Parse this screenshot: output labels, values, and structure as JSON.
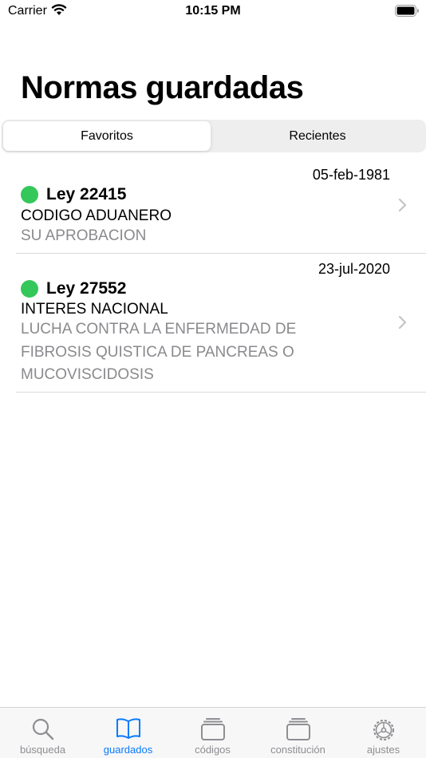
{
  "status_bar": {
    "carrier": "Carrier",
    "time": "10:15 PM"
  },
  "page": {
    "title": "Normas guardadas"
  },
  "segments": [
    {
      "label": "Favoritos",
      "selected": true
    },
    {
      "label": "Recientes",
      "selected": false
    }
  ],
  "items": [
    {
      "date": "05-feb-1981",
      "status_color": "#34c759",
      "name": "Ley 22415",
      "subject": "CODIGO ADUANERO",
      "description": "SU APROBACION"
    },
    {
      "date": "23-jul-2020",
      "status_color": "#34c759",
      "name": "Ley 27552",
      "subject": "INTERES NACIONAL",
      "description": "LUCHA CONTRA LA ENFERMEDAD DE FIBROSIS QUISTICA DE PANCREAS O MUCOVISCIDOSIS"
    }
  ],
  "tab_bar": {
    "active_color": "#0a7aff",
    "tabs": [
      {
        "label": "búsqueda",
        "icon": "search-icon",
        "active": false
      },
      {
        "label": "guardados",
        "icon": "book-icon",
        "active": true
      },
      {
        "label": "códigos",
        "icon": "stack-icon",
        "active": false
      },
      {
        "label": "constitución",
        "icon": "stack-icon",
        "active": false
      },
      {
        "label": "ajustes",
        "icon": "gear-icon",
        "active": false
      }
    ]
  }
}
